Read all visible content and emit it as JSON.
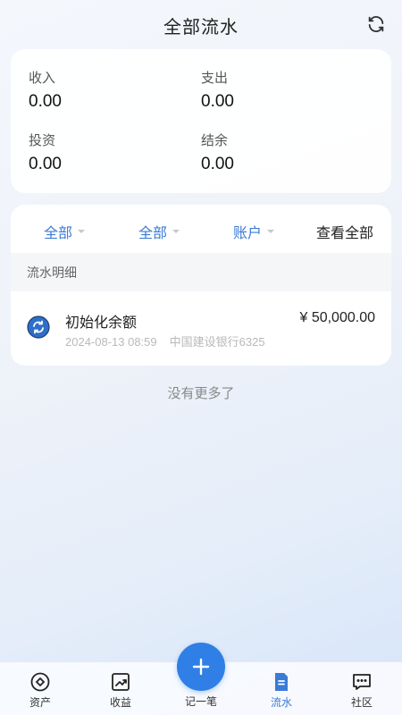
{
  "header": {
    "title": "全部流水",
    "refresh_icon": "refresh-icon"
  },
  "summary": {
    "income_label": "收入",
    "income_value": "0.00",
    "expense_label": "支出",
    "expense_value": "0.00",
    "invest_label": "投资",
    "invest_value": "0.00",
    "balance_label": "结余",
    "balance_value": "0.00"
  },
  "filters": {
    "filter1": "全部",
    "filter2": "全部",
    "filter3": "账户",
    "view_all": "查看全部"
  },
  "section": {
    "title": "流水明细"
  },
  "records": [
    {
      "title": "初始化余额",
      "datetime": "2024-08-13 08:59",
      "account": "中国建设银行6325",
      "amount": "¥ 50,000.00",
      "icon": "sync-icon"
    }
  ],
  "footer_note": "没有更多了",
  "tabbar": {
    "assets": "资产",
    "earnings": "收益",
    "record": "记一笔",
    "flow": "流水",
    "community": "社区"
  },
  "colors": {
    "accent": "#2f7fe6",
    "link": "#3a7bd5"
  }
}
